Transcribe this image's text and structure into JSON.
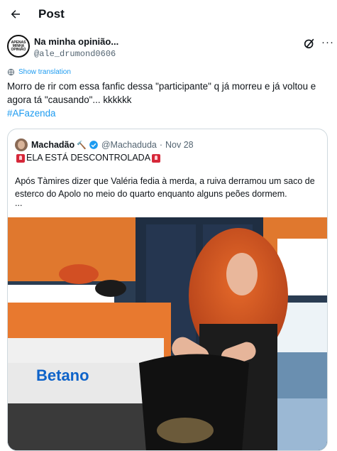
{
  "header": {
    "title": "Post"
  },
  "author": {
    "display_name": "Na minha opinião...",
    "handle": "@ale_drumond0606",
    "avatar_text": "APENAS MINHA OPINIÃO"
  },
  "translate_label": "Show translation",
  "tweet": {
    "text": "Morro de rir com essa fanfic dessa \"participante\" q já morreu e já voltou e agora tá \"causando\"... kkkkkk",
    "hashtag": "#AFazenda"
  },
  "quoted": {
    "display_name": "Machadão",
    "name_emoji": "🔨",
    "handle": "@Machaduda",
    "separator": "·",
    "date": "Nov 28",
    "headline": "ELA ESTÁ DESCONTROLADA",
    "body": "Após Tàmires dizer que Valéria fedia à merda, a ruiva derramou um saco de esterco do Apolo no meio do quarto enquanto alguns peões dormem.",
    "ellipsis": "...",
    "media_logo": "Betano"
  },
  "colors": {
    "accent": "#1d9bf0",
    "text": "#0f1419",
    "muted": "#536471",
    "border": "#cfd9de"
  },
  "icons": [
    "back-arrow-icon",
    "grok-icon",
    "more-icon",
    "translate-icon",
    "verified-icon",
    "siren-icon"
  ]
}
